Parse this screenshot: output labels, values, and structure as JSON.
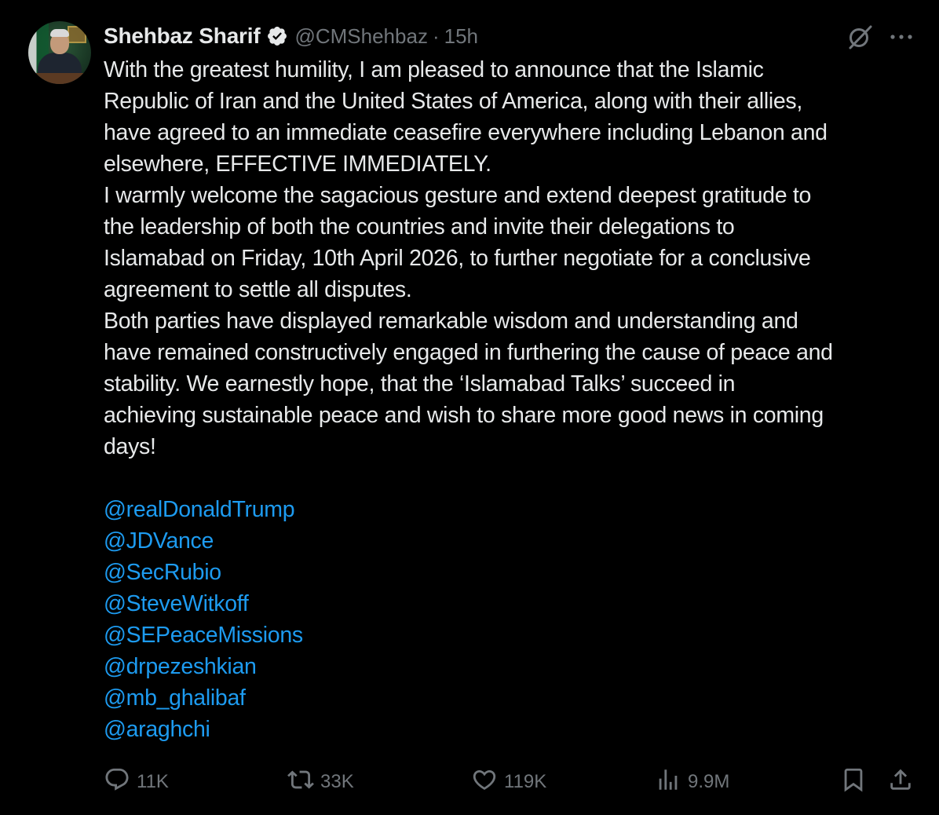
{
  "author": {
    "name": "Shehbaz Sharif",
    "handle": "@CMShehbaz",
    "separator": "·",
    "time": "15h"
  },
  "icons": {
    "verified": "verified-badge-icon",
    "grok": "grok-icon",
    "more": "more-options-icon",
    "reply": "reply-icon",
    "retweet": "retweet-icon",
    "like": "heart-icon",
    "views": "views-chart-icon",
    "bookmark": "bookmark-icon",
    "share": "share-icon"
  },
  "colors": {
    "background": "#000000",
    "text": "#e7e9ea",
    "secondary": "#71767b",
    "link": "#1d9bf0"
  },
  "tweet": {
    "text": "With the greatest humility, I am pleased to announce that the Islamic\nRepublic of Iran and the United States of America, along with their allies,\nhave agreed to an immediate ceasefire everywhere including Lebanon and\nelsewhere, EFFECTIVE IMMEDIATELY.\nI warmly welcome the sagacious gesture and extend deepest gratitude to\nthe leadership of both the countries and invite their delegations to\nIslamabad on Friday, 10th April 2026, to further negotiate for a conclusive\nagreement to settle all disputes.\nBoth parties have displayed remarkable wisdom and understanding and\nhave remained constructively engaged in furthering the cause of peace and\nstability. We earnestly hope, that the ‘Islamabad Talks’ succeed in\nachieving sustainable peace and wish to share more good news in coming\ndays!",
    "mentions": [
      "@realDonaldTrump",
      "@JDVance",
      "@SecRubio",
      "@SteveWitkoff",
      "@SEPeaceMissions",
      "@drpezeshkian",
      "@mb_ghalibaf",
      "@araghchi"
    ]
  },
  "stats": {
    "replies": "11K",
    "retweets": "33K",
    "likes": "119K",
    "views": "9.9M"
  }
}
